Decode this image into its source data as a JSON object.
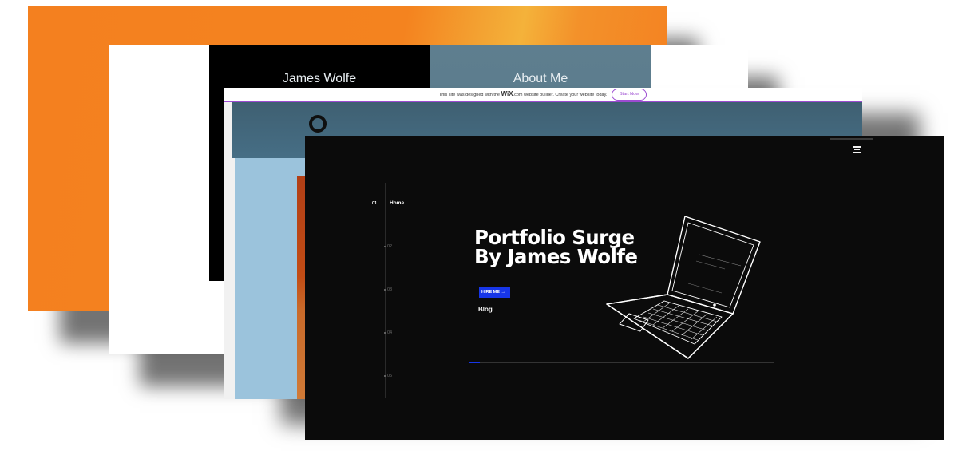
{
  "layer_back_card": {
    "left_heading": "James Wolfe",
    "right_heading": "About Me"
  },
  "wix_card": {
    "banner_text_before": "This site was designed with the",
    "banner_brand": "WiX",
    "banner_text_after": ".com website builder. Create your website today.",
    "banner_button": "Start Now"
  },
  "portfolio": {
    "nav": [
      {
        "number": "01",
        "label": "Home",
        "active": true
      },
      {
        "number": "02",
        "label": "",
        "active": false
      },
      {
        "number": "03",
        "label": "",
        "active": false
      },
      {
        "number": "04",
        "label": "",
        "active": false
      },
      {
        "number": "05",
        "label": "",
        "active": false
      }
    ],
    "title_line1": "Portfolio Surge",
    "title_line2": "By James Wolfe",
    "hire_button": "HIRE ME",
    "hire_arrow": "→",
    "blog_link": "Blog",
    "progress": 0.035,
    "icons": {
      "menu": "hamburger-menu-icon",
      "arrow": "arrow-right-icon",
      "hero": "laptop-illustration"
    }
  },
  "colors": {
    "orange": "#f4801f",
    "slate": "#5e7e8f",
    "wix_purple": "#9c4bd1",
    "accent_blue": "#1736e8",
    "dark_bg": "#0b0b0b",
    "sky_blue": "#9bc3dc",
    "rust": "#c24c15"
  }
}
